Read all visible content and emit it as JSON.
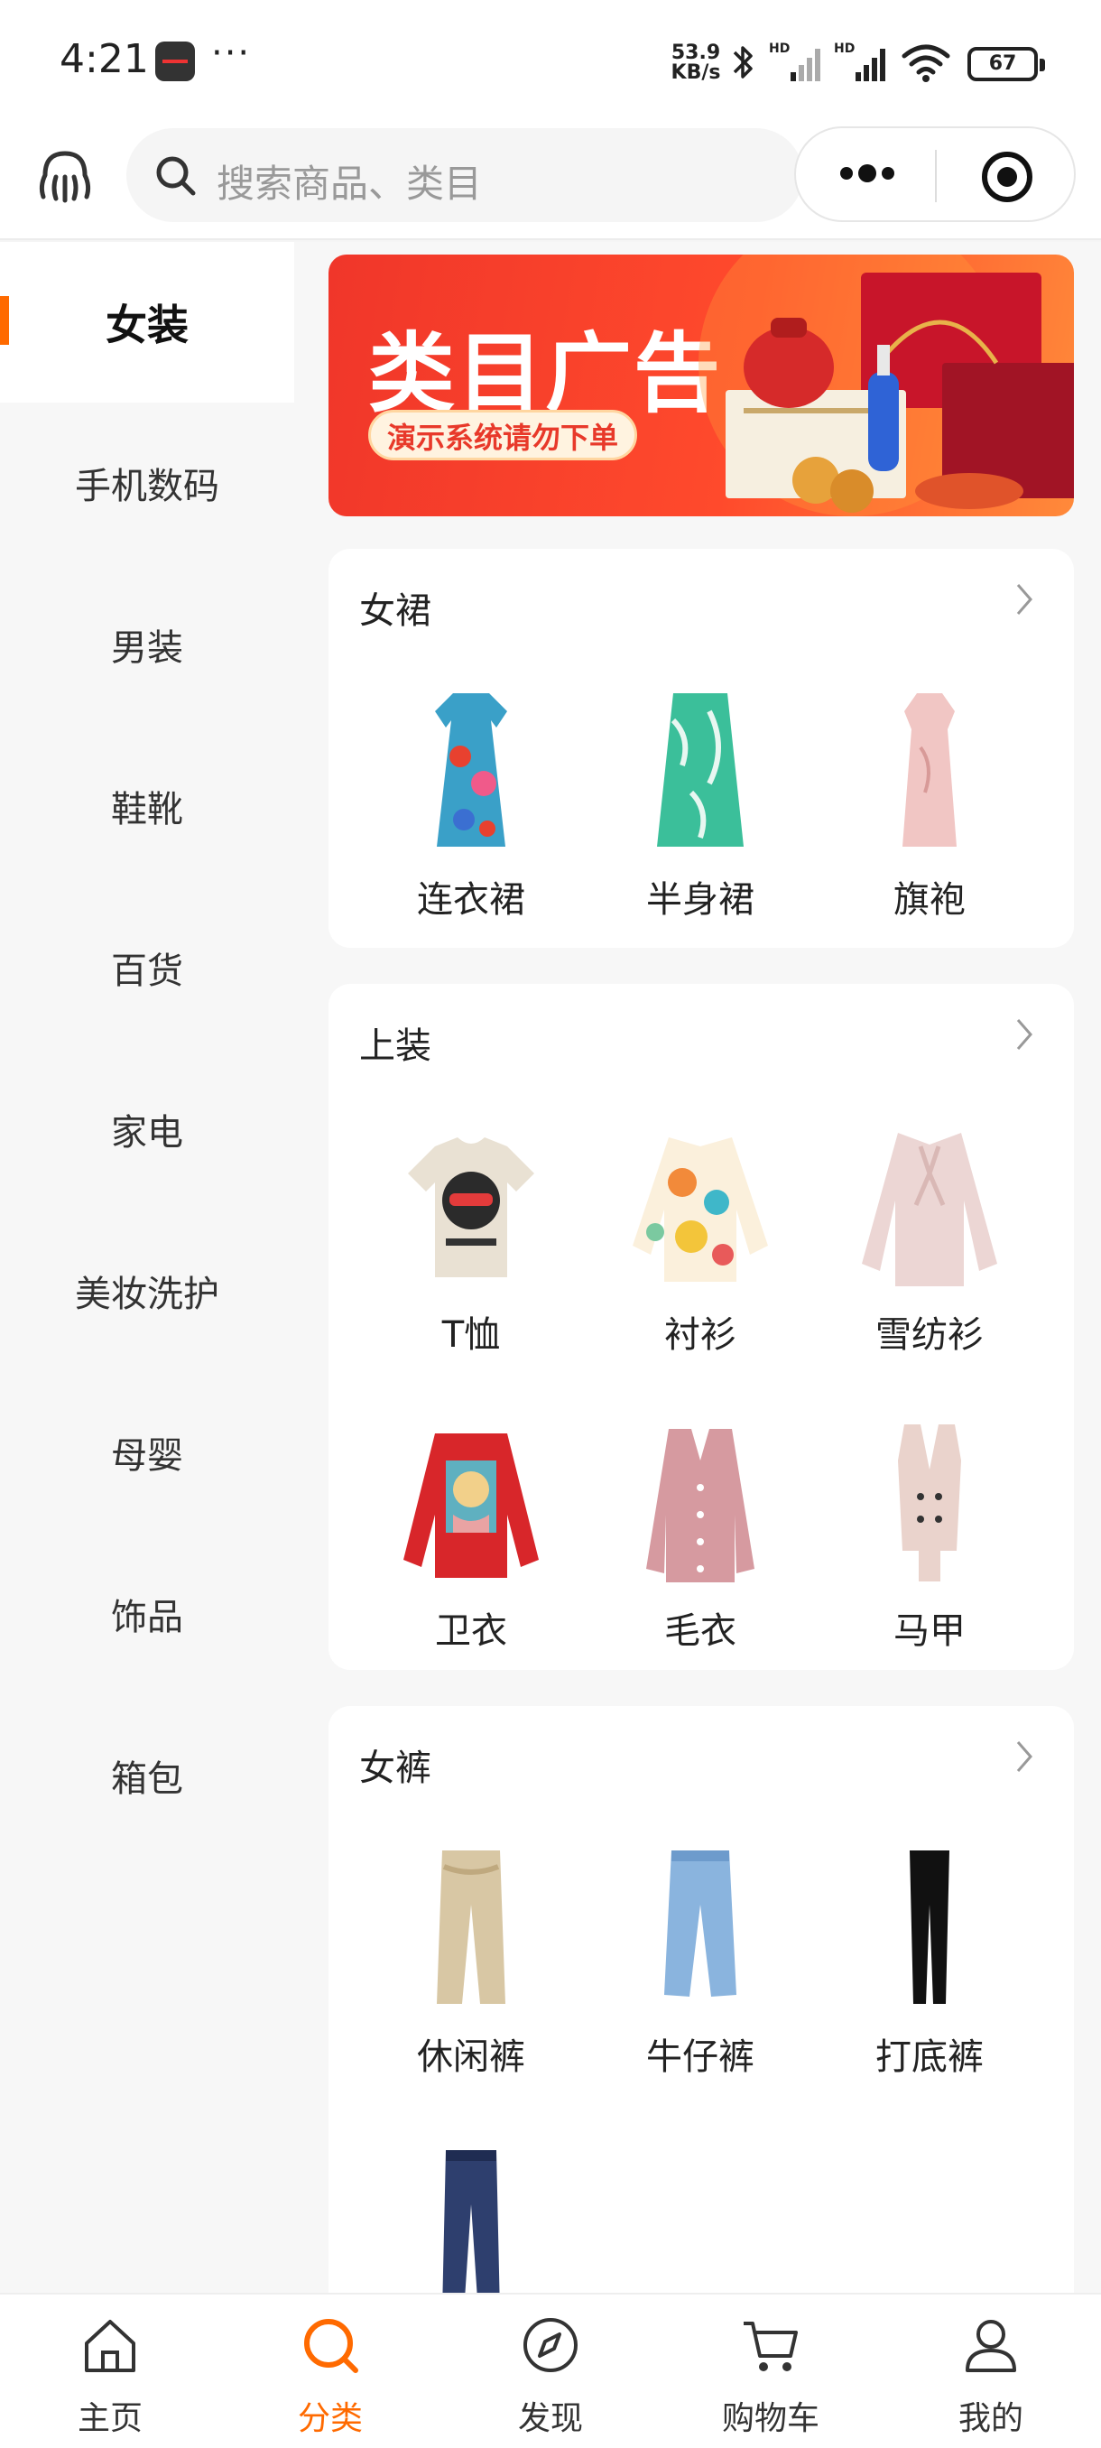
{
  "status_bar": {
    "time": "4:21",
    "more": "···",
    "net_speed_value": "53.9",
    "net_speed_unit": "KB/s",
    "battery": "67",
    "icons": [
      "app-notification-icon",
      "bluetooth-icon",
      "hd-signal-icon",
      "hd-signal-icon",
      "wifi-icon",
      "battery-icon"
    ]
  },
  "header": {
    "brand_icon": "octopus-logo-icon",
    "search_placeholder": "搜索商品、类目",
    "capsule_more_icon": "more-dots-icon",
    "capsule_close_icon": "target-close-icon"
  },
  "sidebar": {
    "items": [
      {
        "label": "女装",
        "active": true
      },
      {
        "label": "手机数码"
      },
      {
        "label": "男装"
      },
      {
        "label": "鞋靴"
      },
      {
        "label": "百货"
      },
      {
        "label": "家电"
      },
      {
        "label": "美妆洗护"
      },
      {
        "label": "母婴"
      },
      {
        "label": "饰品"
      },
      {
        "label": "箱包"
      }
    ]
  },
  "banner": {
    "title": "类目广告",
    "subtitle": "演示系统请勿下单"
  },
  "sections": [
    {
      "title": "女裙",
      "items": [
        {
          "label": "连衣裙"
        },
        {
          "label": "半身裙"
        },
        {
          "label": "旗袍"
        }
      ]
    },
    {
      "title": "上装",
      "items": [
        {
          "label": "T恤"
        },
        {
          "label": "衬衫"
        },
        {
          "label": "雪纺衫"
        },
        {
          "label": "卫衣"
        },
        {
          "label": "毛衣"
        },
        {
          "label": "马甲"
        }
      ]
    },
    {
      "title": "女裤",
      "items": [
        {
          "label": "休闲裤"
        },
        {
          "label": "牛仔裤"
        },
        {
          "label": "打底裤"
        },
        {
          "label": ""
        }
      ]
    }
  ],
  "tabbar": {
    "tabs": [
      {
        "label": "主页",
        "icon": "home-icon"
      },
      {
        "label": "分类",
        "icon": "search-category-icon",
        "active": true
      },
      {
        "label": "发现",
        "icon": "compass-icon"
      },
      {
        "label": "购物车",
        "icon": "cart-icon"
      },
      {
        "label": "我的",
        "icon": "user-icon"
      }
    ]
  },
  "colors": {
    "accent": "#ff6a00",
    "banner_red": "#f0362a",
    "text": "#222222",
    "muted": "#999999"
  }
}
